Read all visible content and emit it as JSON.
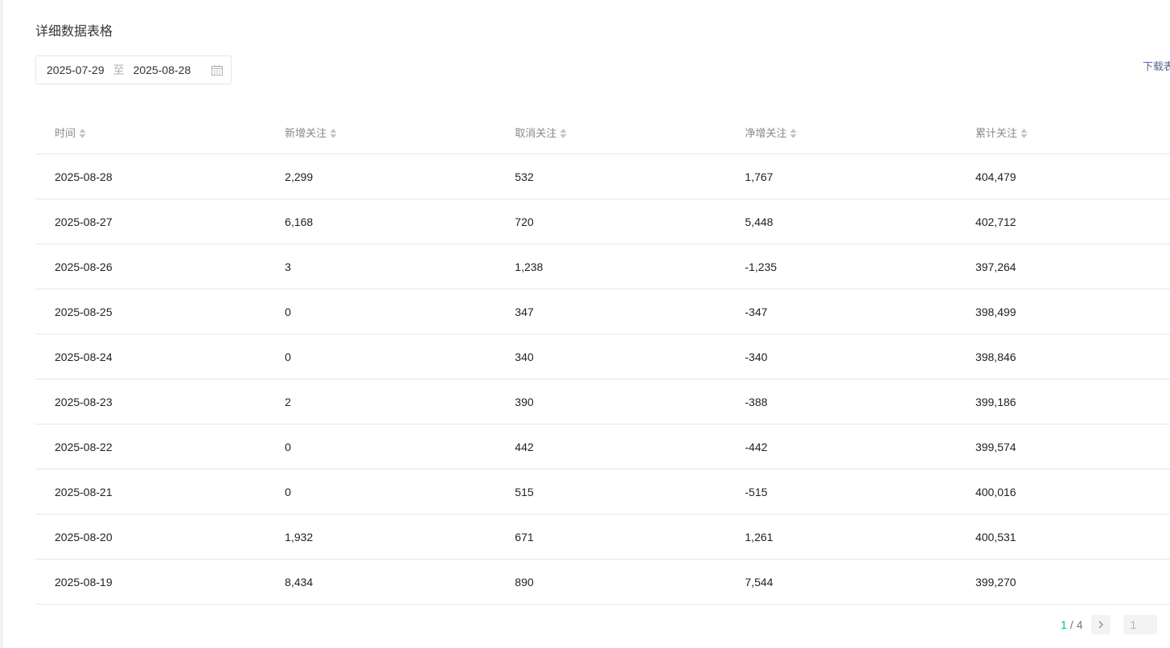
{
  "section": {
    "title": "详细数据表格",
    "download_label": "下载表"
  },
  "date_range": {
    "start": "2025-07-29",
    "separator": "至",
    "end": "2025-08-28"
  },
  "table": {
    "columns": [
      "时间",
      "新增关注",
      "取消关注",
      "净增关注",
      "累计关注"
    ],
    "rows": [
      [
        "2025-08-28",
        "2,299",
        "532",
        "1,767",
        "404,479"
      ],
      [
        "2025-08-27",
        "6,168",
        "720",
        "5,448",
        "402,712"
      ],
      [
        "2025-08-26",
        "3",
        "1,238",
        "-1,235",
        "397,264"
      ],
      [
        "2025-08-25",
        "0",
        "347",
        "-347",
        "398,499"
      ],
      [
        "2025-08-24",
        "0",
        "340",
        "-340",
        "398,846"
      ],
      [
        "2025-08-23",
        "2",
        "390",
        "-388",
        "399,186"
      ],
      [
        "2025-08-22",
        "0",
        "442",
        "-442",
        "399,574"
      ],
      [
        "2025-08-21",
        "0",
        "515",
        "-515",
        "400,016"
      ],
      [
        "2025-08-20",
        "1,932",
        "671",
        "1,261",
        "400,531"
      ],
      [
        "2025-08-19",
        "8,434",
        "890",
        "7,544",
        "399,270"
      ]
    ]
  },
  "pagination": {
    "current": "1",
    "separator": "/",
    "total": "4",
    "input_value": "1"
  },
  "colors": {
    "accent": "#07c160",
    "link": "#576b95",
    "border": "#e7e7eb"
  }
}
